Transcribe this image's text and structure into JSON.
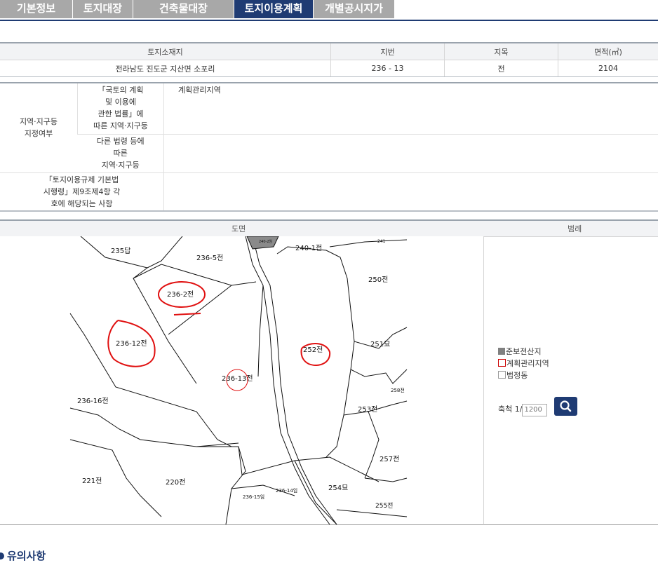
{
  "tabs": [
    {
      "label": "기본정보"
    },
    {
      "label": "토지대장"
    },
    {
      "label": "건축물대장"
    },
    {
      "label": "토지이용계획"
    },
    {
      "label": "개별공시지가"
    }
  ],
  "land": {
    "headers": [
      "토지소재지",
      "지번",
      "지목",
      "면적(㎡)"
    ],
    "row": [
      "전라남도 진도군 지산면 소포리",
      "236 - 13",
      "전",
      "2104"
    ]
  },
  "zoning": {
    "group_label": "지역·지구등\n지정여부",
    "act_label": "「국토의 계획\n및 이용에\n관한 법률」에\n따른 지역·지구등",
    "act_value": "계획관리지역",
    "other_label": "다른 법령 등에\n따른\n지역·지구등",
    "other_value": "",
    "rule_label": "「토지이용규제 기본법\n시행령」제9조제4항 각\n호에 해당되는 사항",
    "rule_value": ""
  },
  "map": {
    "header_map": "도면",
    "header_legend": "범례",
    "parcels": [
      "235답",
      "236-5전",
      "240-1전",
      "250전",
      "236-2전",
      "236-12전",
      "251묘",
      "252전",
      "236-13전",
      "236-16전",
      "253전",
      "257전",
      "221전",
      "220전",
      "254묘",
      "236-15임",
      "236-14임",
      "255전",
      "240-2임",
      "258전",
      "241"
    ]
  },
  "legend": {
    "items": [
      {
        "label": "준보전산지",
        "color": "#808080",
        "style": "fill"
      },
      {
        "label": "계획관리지역",
        "color": "#cc0000",
        "style": "outline"
      },
      {
        "label": "법정동",
        "color": "#999999",
        "style": "outline"
      }
    ],
    "scale_label": "축척 1/",
    "scale_placeholder": "1200",
    "search_icon": "search-icon"
  },
  "notice": {
    "title": "유의사항"
  }
}
